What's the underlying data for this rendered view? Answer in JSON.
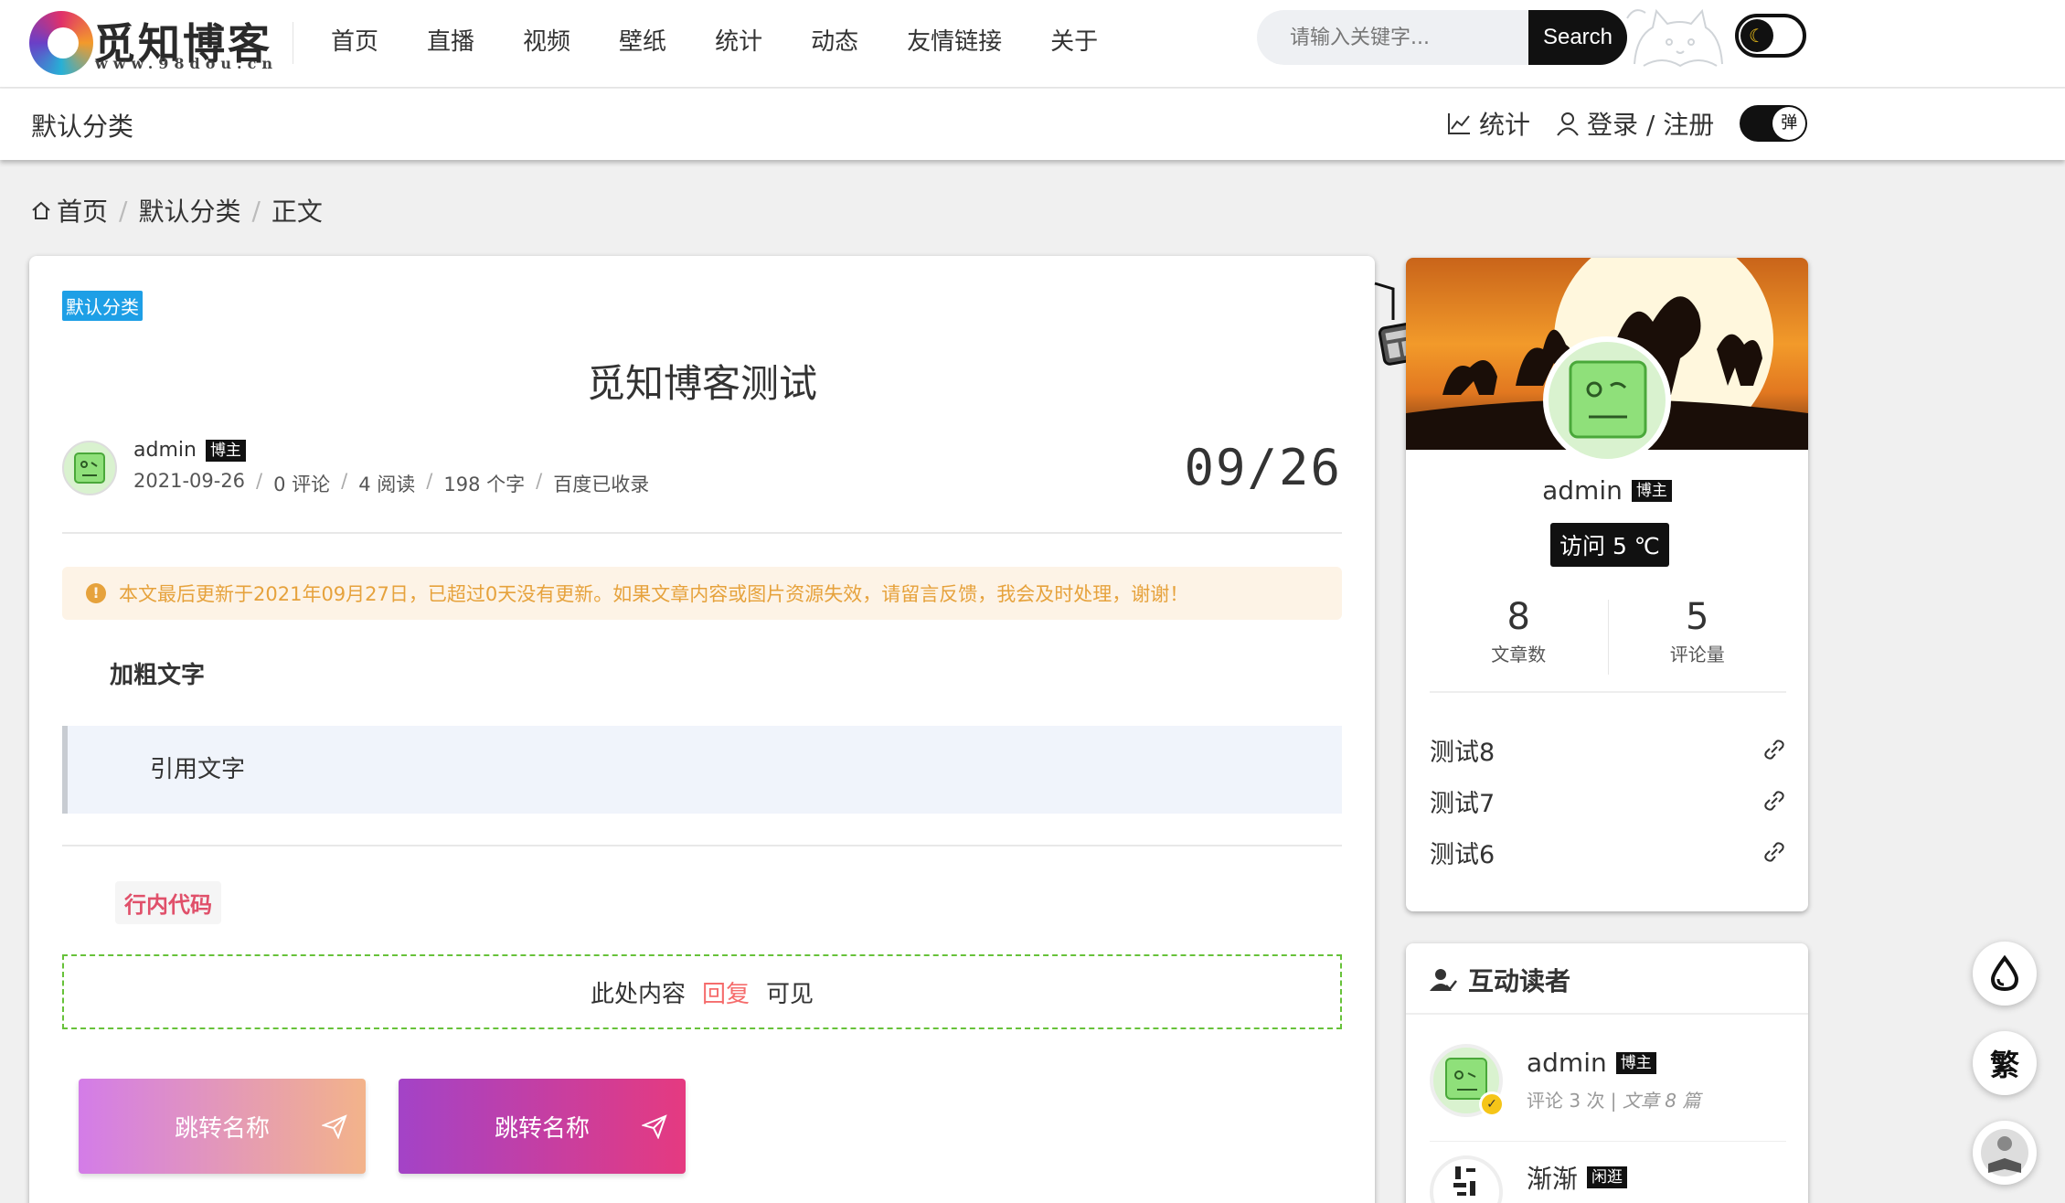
{
  "site": {
    "logo_title": "觅知博客",
    "logo_sub": "www.98dou.cn"
  },
  "nav": {
    "items": [
      "首页",
      "直播",
      "视频",
      "壁纸",
      "统计",
      "动态",
      "友情链接",
      "关于"
    ]
  },
  "search": {
    "placeholder": "请输入关键字...",
    "button_label": "Search"
  },
  "subbar": {
    "title": "默认分类",
    "stats_label": "统计",
    "login_label": "登录 / 注册",
    "popup_toggle_label": "弹"
  },
  "breadcrumb": {
    "home": "首页",
    "category": "默认分类",
    "current": "正文"
  },
  "article": {
    "category_tag": "默认分类",
    "title": "觅知博客测试",
    "author": "admin",
    "author_badge": "博主",
    "date": "2021-09-26",
    "comments": "0 评论",
    "reads": "4 阅读",
    "words": "198 个字",
    "indexed": "百度已收录",
    "date_big": "09/26",
    "notice": "本文最后更新于2021年09月27日，已超过0天没有更新。如果文章内容或图片资源失效，请留言反馈，我会及时处理，谢谢！",
    "bold_text": "加粗文字",
    "quote_text": "引用文字",
    "inline_code": "行内代码",
    "reply_prefix": "此处内容",
    "reply_link": "回复",
    "reply_suffix": "可见",
    "jump_buttons": [
      "跳转名称",
      "跳转名称"
    ]
  },
  "profile": {
    "name": "admin",
    "badge": "博主",
    "visit_label": "访问 5 ℃",
    "stats": [
      {
        "value": "8",
        "label": "文章数"
      },
      {
        "value": "5",
        "label": "评论量"
      }
    ],
    "links": [
      "测试8",
      "测试7",
      "测试6"
    ]
  },
  "readers": {
    "title": "互动读者",
    "items": [
      {
        "name": "admin",
        "badge": "博主",
        "comments": "评论 3 次 | ",
        "articles": "文章 8 篇"
      },
      {
        "name": "渐渐",
        "badge": "闲逛"
      }
    ]
  },
  "floating": {
    "traditional_label": "繁"
  },
  "colors": {
    "accent_tag": "#1e9fe6",
    "notice_text": "#e6a23c",
    "notice_bg": "#fdf3e6",
    "reply_border": "#67c23a",
    "reply_link": "#f56c6c",
    "inline_code": "#e0506a",
    "badge_bg": "#111111"
  }
}
